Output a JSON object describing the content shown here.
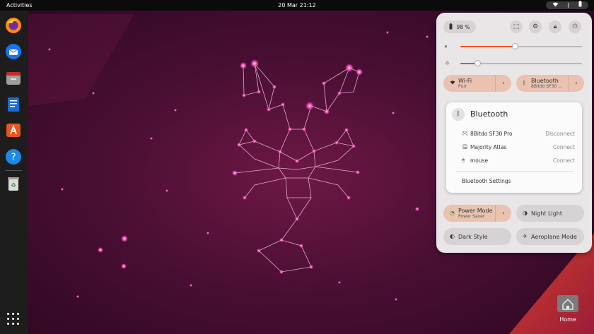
{
  "topbar": {
    "activities_label": "Activities",
    "date_time": "20 Mar  21:12"
  },
  "dock": {
    "apps": [
      "firefox-icon",
      "thunderbird-icon",
      "files-icon",
      "libreoffice-writer-icon",
      "app-center-icon",
      "help-icon",
      "trash-icon"
    ],
    "show_apps": "show-apps-icon"
  },
  "quick_settings": {
    "battery": "98 %",
    "volume_level": 0.45,
    "brightness_level": 0.14,
    "wifi": {
      "label": "Wi-Fi",
      "sub": "Purr",
      "on": true
    },
    "bluetooth": {
      "label": "Bluetooth",
      "sub": "8Bitdo SF30 ...",
      "on": true
    },
    "power_mode": {
      "label": "Power Mode",
      "sub": "Power Saver",
      "on": true
    },
    "night_light": {
      "label": "Night Light",
      "on": false
    },
    "dark_style": {
      "label": "Dark Style",
      "on": false
    },
    "aeroplane_mode": {
      "label": "Aeroplane Mode",
      "on": false
    },
    "accent_color": "#e95420"
  },
  "bluetooth_menu": {
    "title": "Bluetooth",
    "devices": [
      {
        "name": "8Bitdo SF30 Pro",
        "action": "Disconnect",
        "icon": "gamepad-icon"
      },
      {
        "name": "Majority Atlas",
        "action": "Connect",
        "icon": "headphones-icon"
      },
      {
        "name": "mouse",
        "action": "Connect",
        "icon": "mouse-icon"
      }
    ],
    "settings_label": "Bluetooth Settings"
  },
  "desktop": {
    "home_label": "Home"
  }
}
